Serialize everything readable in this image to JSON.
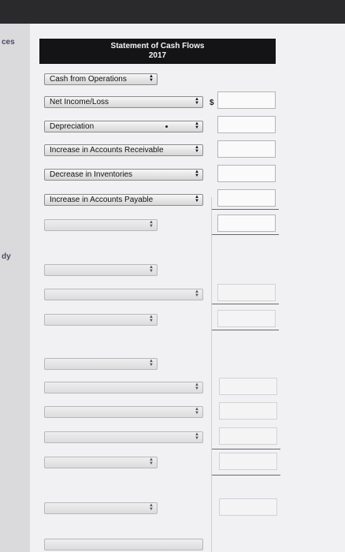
{
  "sidebar": {
    "fragment_top": "ces",
    "fragment_mid": "dy"
  },
  "statement": {
    "title": "Statement of Cash Flows",
    "year": "2017"
  },
  "section_label": "Cash from Operations",
  "currency_symbol": "$",
  "rows": [
    {
      "label": "Net Income/Loss"
    },
    {
      "label": "Depreciation"
    },
    {
      "label": "Increase in Accounts Receivable"
    },
    {
      "label": "Decrease in Inventories"
    },
    {
      "label": "Increase in Accounts Payable"
    },
    {
      "label": ""
    },
    {
      "label": ""
    },
    {
      "label": ""
    },
    {
      "label": ""
    },
    {
      "label": ""
    },
    {
      "label": ""
    },
    {
      "label": ""
    },
    {
      "label": ""
    },
    {
      "label": ""
    },
    {
      "label": ""
    },
    {
      "label": ""
    }
  ]
}
